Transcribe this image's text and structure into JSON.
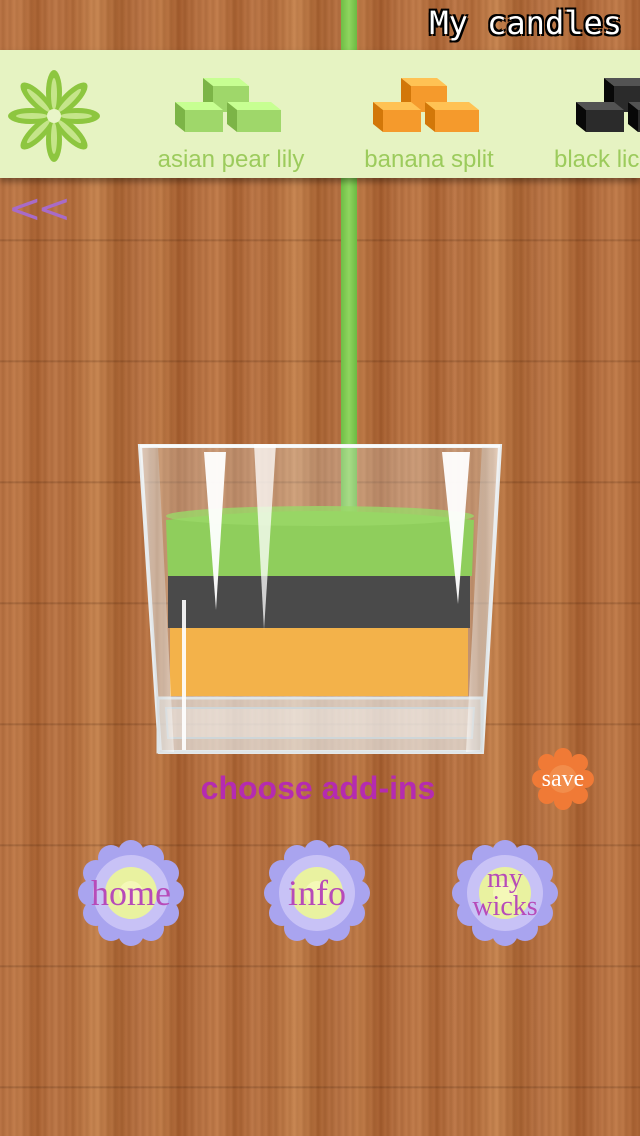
{
  "header": {
    "title": "My candles"
  },
  "shelf": {
    "items": [
      {
        "label": "asian pear lily",
        "color": "#9fd76a"
      },
      {
        "label": "banana split",
        "color": "#f59a2c"
      },
      {
        "label": "black lic",
        "color": "#2b2b2b"
      }
    ]
  },
  "nav": {
    "back_label": "<<"
  },
  "candle": {
    "layers": [
      {
        "name": "green",
        "color": "#8fce5c"
      },
      {
        "name": "black",
        "color": "#4a4a4a"
      },
      {
        "name": "orange",
        "color": "#f3b24a"
      }
    ]
  },
  "actions": {
    "choose_addins": "choose add-ins",
    "save": "save",
    "home": "home",
    "info": "info",
    "my_wicks_line1": "my",
    "my_wicks_line2": "wicks"
  }
}
